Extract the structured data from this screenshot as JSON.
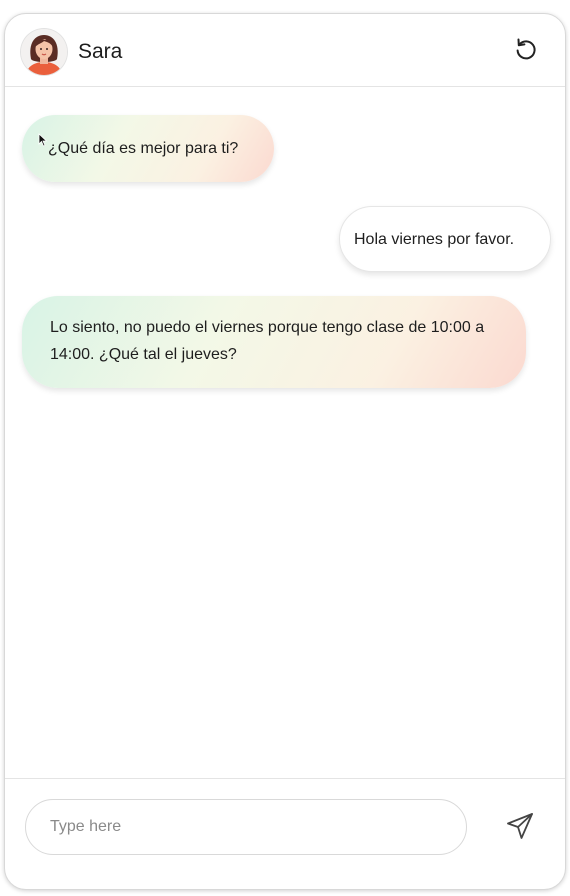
{
  "header": {
    "contact_name": "Sara",
    "avatar_icon": "woman-avatar-icon",
    "reset_icon": "restart-icon"
  },
  "messages": [
    {
      "sender": "contact",
      "text": "¿Qué día es mejor para ti?"
    },
    {
      "sender": "user",
      "text": "Hola viernes por favor."
    },
    {
      "sender": "contact",
      "text": "Lo siento, no puedo el viernes porque tengo clase de 10:00 a 14:00. ¿Qué tal el jueves?"
    }
  ],
  "composer": {
    "placeholder": "Type here",
    "value": "",
    "send_icon": "send-icon"
  },
  "colors": {
    "gradient_green": "#d8f3e6",
    "gradient_peach": "#fbd9d0",
    "border": "#d8d8d8"
  }
}
